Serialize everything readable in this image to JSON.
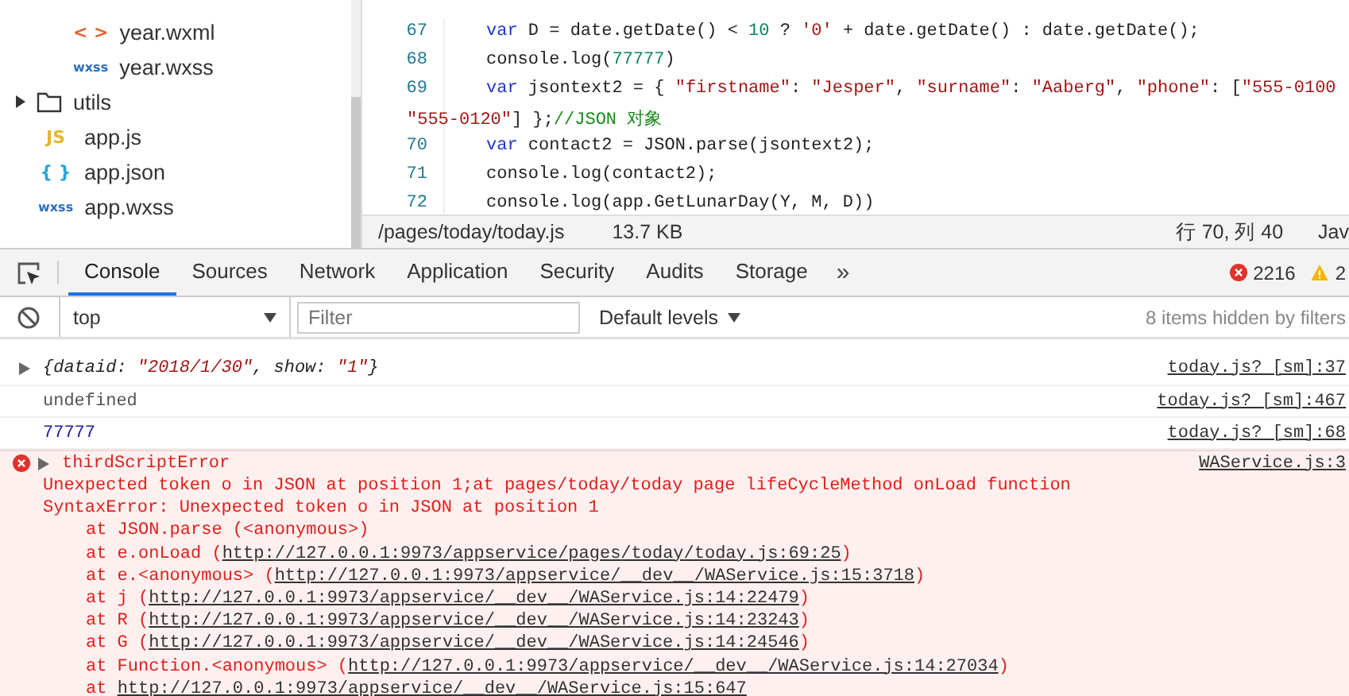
{
  "sidebar": {
    "nested_items": [
      {
        "label": "year.wxml",
        "kind": "wxml",
        "icon": "< >"
      },
      {
        "label": "year.wxss",
        "kind": "wxss",
        "icon": "wxss"
      }
    ],
    "items": [
      {
        "label": "utils",
        "kind": "folder",
        "expanded": false
      },
      {
        "label": "app.js",
        "kind": "js",
        "icon": "JS"
      },
      {
        "label": "app.json",
        "kind": "json",
        "icon": "{ }"
      },
      {
        "label": "app.wxss",
        "kind": "wxss",
        "icon": "wxss"
      }
    ]
  },
  "editor": {
    "lines": [
      {
        "number": "67",
        "segments": [
          {
            "text": "var",
            "kind": "keyword"
          },
          {
            "text": " D = date.getDate() < "
          },
          {
            "text": "10",
            "kind": "number"
          },
          {
            "text": " ? "
          },
          {
            "text": "'0'",
            "kind": "string"
          },
          {
            "text": " + date.getDate() : date.getDate();"
          }
        ]
      },
      {
        "number": "68",
        "segments": [
          {
            "text": "console.log("
          },
          {
            "text": "77777",
            "kind": "number"
          },
          {
            "text": ")"
          }
        ]
      },
      {
        "number": "69",
        "segments": [
          {
            "text": "var",
            "kind": "keyword"
          },
          {
            "text": " jsontext2 = { "
          },
          {
            "text": "\"firstname\"",
            "kind": "string"
          },
          {
            "text": ": "
          },
          {
            "text": "\"Jesper\"",
            "kind": "string"
          },
          {
            "text": ", "
          },
          {
            "text": "\"surname\"",
            "kind": "string"
          },
          {
            "text": ": "
          },
          {
            "text": "\"Aaberg\"",
            "kind": "string"
          },
          {
            "text": ", "
          },
          {
            "text": "\"phone\"",
            "kind": "string"
          },
          {
            "text": ": ["
          },
          {
            "text": "\"555-0100",
            "kind": "string"
          }
        ]
      },
      {
        "segments": [
          {
            "text": "\"555-0120\"",
            "kind": "string"
          },
          {
            "text": "] };"
          },
          {
            "text": "//JSON 对象",
            "kind": "comment"
          }
        ]
      },
      {
        "number": "70",
        "segments": [
          {
            "text": "var",
            "kind": "keyword"
          },
          {
            "text": " contact2 = JSON.parse(jsontext2);"
          }
        ]
      },
      {
        "number": "71",
        "segments": [
          {
            "text": "console.log(contact2);"
          }
        ]
      },
      {
        "number": "72",
        "segments": [
          {
            "text": "console.log(app.GetLunarDay(Y, M, D))"
          }
        ]
      }
    ],
    "status_bar": {
      "path": "/pages/today/today.js",
      "size": "13.7 KB",
      "position": "行 70, 列 40",
      "language": "Jav"
    }
  },
  "devtools": {
    "tabs": [
      {
        "label": "Console",
        "selected": true
      },
      {
        "label": "Sources",
        "selected": false
      },
      {
        "label": "Network",
        "selected": false
      },
      {
        "label": "Application",
        "selected": false
      },
      {
        "label": "Security",
        "selected": false
      },
      {
        "label": "Audits",
        "selected": false
      },
      {
        "label": "Storage",
        "selected": false
      }
    ],
    "more_tabs": "»",
    "error_count": "2216",
    "warning_count": "2",
    "toolbar": {
      "context": "top",
      "filter_placeholder": "Filter",
      "levels": "Default levels",
      "hidden_note": "8 items hidden by filters"
    },
    "console": [
      {
        "kind": "object",
        "segments": [
          {
            "text": "{dataid: "
          },
          {
            "text": "\"2018/1/30\"",
            "kind": "string"
          },
          {
            "text": ", show: "
          },
          {
            "text": "\"1\"",
            "kind": "string"
          },
          {
            "text": "}"
          }
        ],
        "source": "today.js? [sm]:37"
      },
      {
        "kind": "plain",
        "segments": [
          {
            "text": "undefined"
          }
        ],
        "source": "today.js? [sm]:467"
      },
      {
        "kind": "number",
        "segments": [
          {
            "text": "77777"
          }
        ],
        "source": "today.js? [sm]:68"
      },
      {
        "kind": "error",
        "title": "thirdScriptError",
        "source": "WAService.js:3",
        "lines": [
          {
            "kind": "message",
            "segments": [
              {
                "text": "Unexpected token o in JSON at position 1;at pages/today/today page lifeCycleMethod onLoad function"
              }
            ]
          },
          {
            "kind": "message",
            "segments": [
              {
                "text": "SyntaxError: Unexpected token o in JSON at position 1"
              }
            ]
          },
          {
            "kind": "frame",
            "segments": [
              {
                "text": "at JSON.parse (<anonymous>)"
              }
            ]
          },
          {
            "kind": "frame",
            "segments": [
              {
                "text": "at e.onLoad ("
              },
              {
                "text": "http://127.0.0.1:9973/appservice/pages/today/today.js:69:25",
                "kind": "link"
              },
              {
                "text": ")"
              }
            ]
          },
          {
            "kind": "frame",
            "segments": [
              {
                "text": "at e.<anonymous> ("
              },
              {
                "text": "http://127.0.0.1:9973/appservice/__dev__/WAService.js:15:3718",
                "kind": "link"
              },
              {
                "text": ")"
              }
            ]
          },
          {
            "kind": "frame",
            "segments": [
              {
                "text": "at j ("
              },
              {
                "text": "http://127.0.0.1:9973/appservice/__dev__/WAService.js:14:22479",
                "kind": "link"
              },
              {
                "text": ")"
              }
            ]
          },
          {
            "kind": "frame",
            "segments": [
              {
                "text": "at R ("
              },
              {
                "text": "http://127.0.0.1:9973/appservice/__dev__/WAService.js:14:23243",
                "kind": "link"
              },
              {
                "text": ")"
              }
            ]
          },
          {
            "kind": "frame",
            "segments": [
              {
                "text": "at G ("
              },
              {
                "text": "http://127.0.0.1:9973/appservice/__dev__/WAService.js:14:24546",
                "kind": "link"
              },
              {
                "text": ")"
              }
            ]
          },
          {
            "kind": "frame",
            "segments": [
              {
                "text": "at Function.<anonymous> ("
              },
              {
                "text": "http://127.0.0.1:9973/appservice/__dev__/WAService.js:14:27034",
                "kind": "link"
              },
              {
                "text": ")"
              }
            ]
          },
          {
            "kind": "frame",
            "segments": [
              {
                "text": "at "
              },
              {
                "text": "http://127.0.0.1:9973/appservice/__dev__/WAService.js:15:647",
                "kind": "link"
              }
            ]
          }
        ]
      }
    ]
  }
}
